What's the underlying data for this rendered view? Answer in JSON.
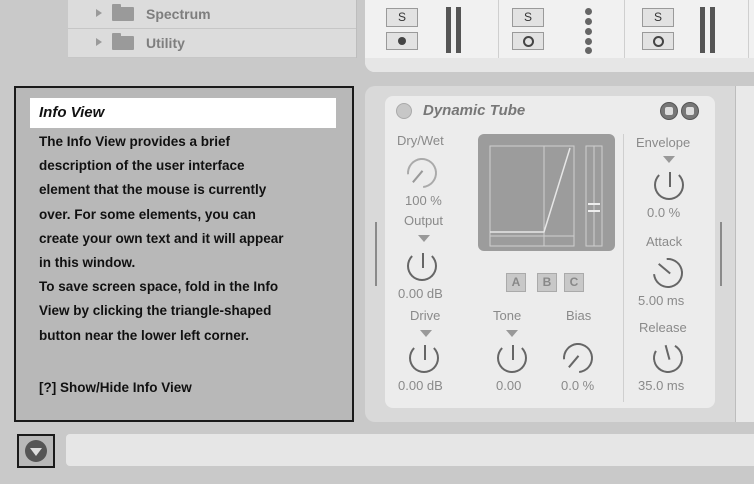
{
  "browser": {
    "items": [
      {
        "label": "Spectrum",
        "icon": "folder-icon"
      },
      {
        "label": "Utility",
        "icon": "folder-icon"
      }
    ]
  },
  "mixer": {
    "tracks": [
      {
        "solo_label": "S",
        "arm": "record-dot"
      },
      {
        "solo_label": "S",
        "arm": "monitor-ring"
      },
      {
        "solo_label": "S",
        "arm": "monitor-ring"
      }
    ]
  },
  "info_view": {
    "title": "Info View",
    "lines": [
      "The Info View provides a brief",
      "description of the user interface",
      "element that the mouse is currently",
      "over. For some elements, you can",
      "create your own text and it will appear",
      "in this window.",
      "To save screen space, fold in the Info",
      "View by clicking the triangle-shaped",
      "button near the lower left corner."
    ],
    "footer": "[?] Show/Hide Info View"
  },
  "device": {
    "title": "Dynamic Tube",
    "drywet": {
      "label": "Dry/Wet",
      "value": "100 %"
    },
    "output": {
      "label": "Output",
      "value": "0.00 dB"
    },
    "drive": {
      "label": "Drive",
      "value": "0.00 dB"
    },
    "tone": {
      "label": "Tone",
      "value": "0.00"
    },
    "bias": {
      "label": "Bias",
      "value": "0.0 %"
    },
    "envelope": {
      "label": "Envelope",
      "value": "0.0 %"
    },
    "attack": {
      "label": "Attack",
      "value": "5.00 ms"
    },
    "release": {
      "label": "Release",
      "value": "35.0 ms"
    },
    "modes": [
      "A",
      "B",
      "C"
    ]
  },
  "colors": {
    "background": "#c9c9c9",
    "panel": "#ececec",
    "info_title_bg": "#ffffff",
    "display": "#9c9c9c"
  }
}
